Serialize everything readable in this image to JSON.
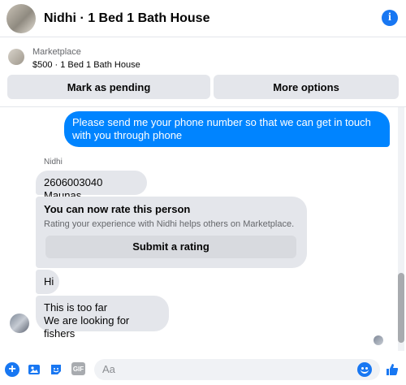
{
  "header": {
    "title": "Nidhi · 1 Bed 1 Bath House",
    "avatar_icon": "house-photo-avatar",
    "info_icon": "info-icon"
  },
  "marketplace": {
    "label": "Marketplace",
    "listing": "$500 · 1 Bed 1 Bath House",
    "buttons": {
      "pending": "Mark as pending",
      "more": "More options"
    }
  },
  "messages": {
    "outgoing_1": "Please send me your phone  number so that we can get in touch with you through phone",
    "sender_name": "Nidhi",
    "incoming_1": "2606003040 Maunas",
    "rating_card": {
      "title": "You can now rate this person",
      "text": "Rating your experience with Nidhi helps others on Marketplace.",
      "button": "Submit a rating"
    },
    "incoming_2": "Hi",
    "incoming_3_line1": "This is too far",
    "incoming_3_line2": "We are looking for fishers"
  },
  "composer": {
    "placeholder": "Aa",
    "gif_label": "GIF"
  },
  "colors": {
    "accent": "#1877f2",
    "outgoing_bubble": "#0084ff",
    "incoming_bubble": "#e4e6eb"
  }
}
